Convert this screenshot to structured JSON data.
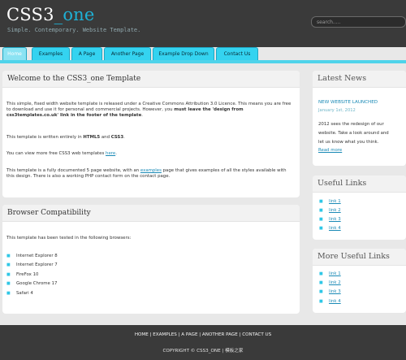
{
  "header": {
    "title_main": "CSS3",
    "title_accent": "_one",
    "slogan": "Simple. Contemporary. Website Template.",
    "search_placeholder": "search....."
  },
  "nav": {
    "items": [
      {
        "label": "Home"
      },
      {
        "label": "Examples"
      },
      {
        "label": "A Page"
      },
      {
        "label": "Another Page"
      },
      {
        "label": "Example Drop Down"
      },
      {
        "label": "Contact Us"
      }
    ]
  },
  "main": {
    "welcome": {
      "heading": "Welcome to the CSS3_one Template",
      "p1_a": "This simple, fixed width website template is released under a Creative Commons Attribution 3.0 Licence. This means you",
      "p1_b": "are free to download and use it for personal and commercial projects. However, you",
      "p1_bold1": "must leave the 'design from",
      "p1_bold2": "css3templates.co.uk' link in the footer of the template",
      "p1_end": ".",
      "p2_a": "This template is written entirely in",
      "p2_html5": "HTML5",
      "p2_and": "and",
      "p2_css3": "CSS3",
      "p2_end": ".",
      "p3_a": "You can view more free CSS3 web templates",
      "p3_link": "here",
      "p3_end": ".",
      "p4_a": "This template is a fully documented 5 page website, with an",
      "p4_link": "examples",
      "p4_b": "page that gives examples of all the styles available",
      "p4_c": "with this design. There is also a working PHP contact form on the contact page."
    },
    "browser": {
      "heading": "Browser Compatibility",
      "intro": "This template has been tested in the following browsers:",
      "list": [
        "Internet Explorer 8",
        "Internet Explorer 7",
        "FireFox 10",
        "Google Chrome 17",
        "Safari 4"
      ]
    }
  },
  "sidebar": {
    "news": {
      "heading": "Latest News",
      "title": "NEW WEBSITE LAUNCHED",
      "date": "January 1st, 2012",
      "body1": "2012 sees the redesign of our",
      "body2": "website. Take a look around and",
      "body3": "let us know what you think.",
      "read_more": "Read more"
    },
    "useful": {
      "heading": "Useful Links",
      "links": [
        "link 1",
        "link 2",
        "link 3",
        "link 4"
      ]
    },
    "more_useful": {
      "heading": "More Useful Links",
      "links": [
        "link 1",
        "link 2",
        "link 3",
        "link 4"
      ]
    }
  },
  "footer": {
    "nav": "HOME | EXAMPLES | A PAGE | ANOTHER PAGE | CONTACT US",
    "copyright": "COPYRIGHT © CSS3_ONE | 模板之家"
  },
  "colors": {
    "accent": "#1eb1d6",
    "nav_tab": "#34d3f0",
    "header_bg": "#3a3a3a"
  }
}
